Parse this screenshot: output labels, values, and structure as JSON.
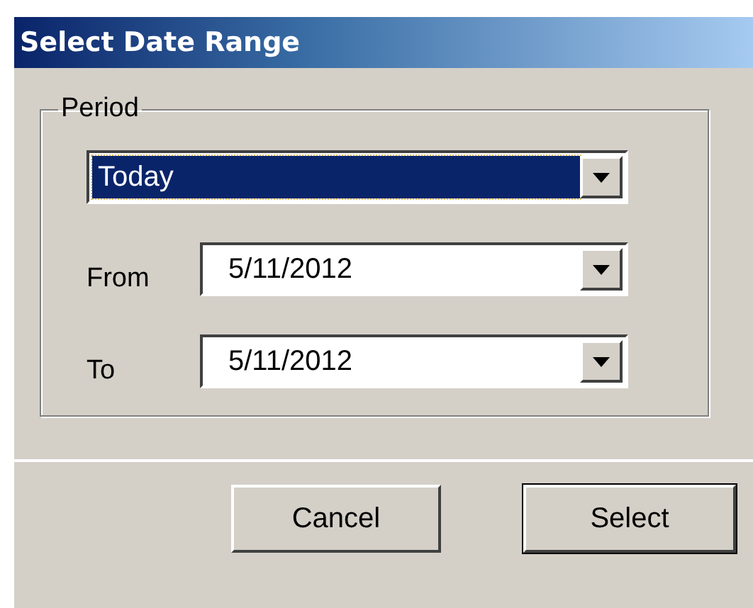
{
  "window": {
    "title": "Select Date Range"
  },
  "period_group": {
    "label": "Period",
    "period": {
      "value": "Today",
      "focused": true
    },
    "fields": [
      {
        "label": "From",
        "value": "5/11/2012",
        "focused": false
      },
      {
        "label": "To",
        "value": "5/11/2012",
        "focused": false
      }
    ]
  },
  "buttons": [
    {
      "label": "Cancel",
      "default": false
    },
    {
      "label": "Select",
      "default": true
    }
  ]
}
